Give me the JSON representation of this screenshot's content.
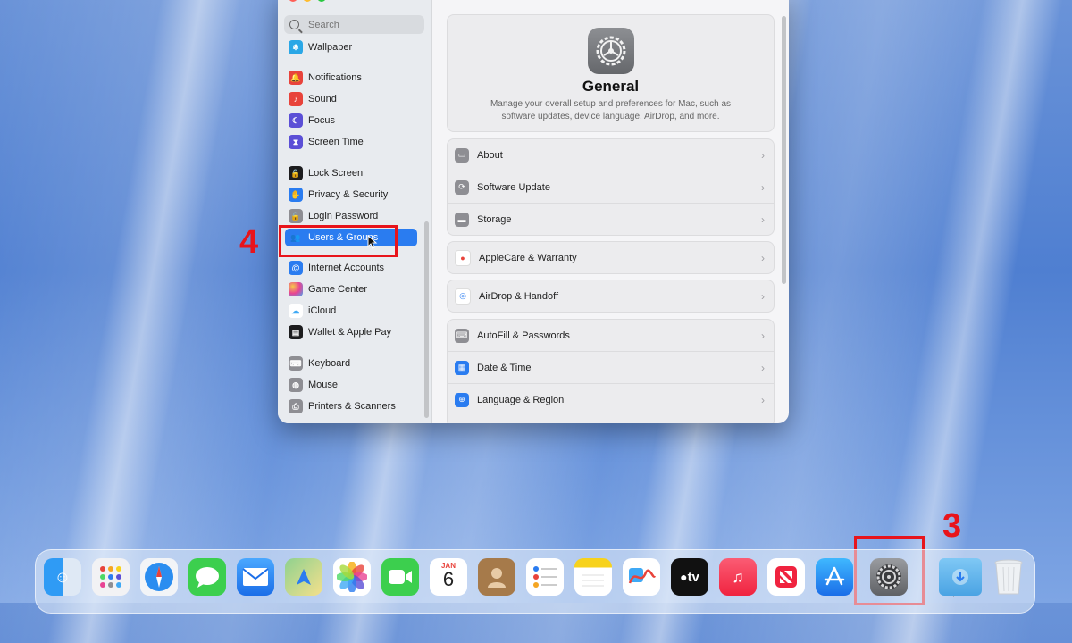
{
  "sidebar": {
    "search_placeholder": "Search",
    "items": [
      {
        "label": "Wallpaper",
        "icon": "wallpaper-icon",
        "color": "#2aa7e6"
      },
      {
        "label": "Notifications",
        "icon": "bell-icon",
        "color": "#e8433b"
      },
      {
        "label": "Sound",
        "icon": "speaker-icon",
        "color": "#e8433b"
      },
      {
        "label": "Focus",
        "icon": "moon-icon",
        "color": "#5b4fd6"
      },
      {
        "label": "Screen Time",
        "icon": "hourglass-icon",
        "color": "#5b4fd6"
      },
      {
        "label": "Lock Screen",
        "icon": "lock-icon",
        "color": "#1c1c1e"
      },
      {
        "label": "Privacy & Security",
        "icon": "hand-icon",
        "color": "#2a7cf0"
      },
      {
        "label": "Login Password",
        "icon": "lock-icon",
        "color": "#8e8e93"
      },
      {
        "label": "Users & Groups",
        "icon": "users-icon",
        "color": "#2a7cf0"
      },
      {
        "label": "Internet Accounts",
        "icon": "at-icon",
        "color": "#2a7cf0"
      },
      {
        "label": "Game Center",
        "icon": "game-center-icon",
        "color": "#d0d0d4"
      },
      {
        "label": "iCloud",
        "icon": "cloud-icon",
        "color": "#ffffff"
      },
      {
        "label": "Wallet & Apple Pay",
        "icon": "wallet-icon",
        "color": "#1c1c1e"
      },
      {
        "label": "Keyboard",
        "icon": "keyboard-icon",
        "color": "#8e8e93"
      },
      {
        "label": "Mouse",
        "icon": "mouse-icon",
        "color": "#8e8e93"
      },
      {
        "label": "Printers & Scanners",
        "icon": "printer-icon",
        "color": "#8e8e93"
      }
    ]
  },
  "main": {
    "title": "General",
    "description": "Manage your overall setup and preferences for Mac, such as software updates, device language, AirDrop, and more.",
    "groups": [
      [
        "About",
        "Software Update",
        "Storage"
      ],
      [
        "AppleCare & Warranty"
      ],
      [
        "AirDrop & Handoff"
      ],
      [
        "AutoFill & Passwords",
        "Date & Time",
        "Language & Region"
      ]
    ]
  },
  "annotations": {
    "step_4": "4",
    "step_3": "3"
  },
  "dock": {
    "calendar_month": "JAN",
    "calendar_day": "6",
    "tv_label": "tv"
  }
}
